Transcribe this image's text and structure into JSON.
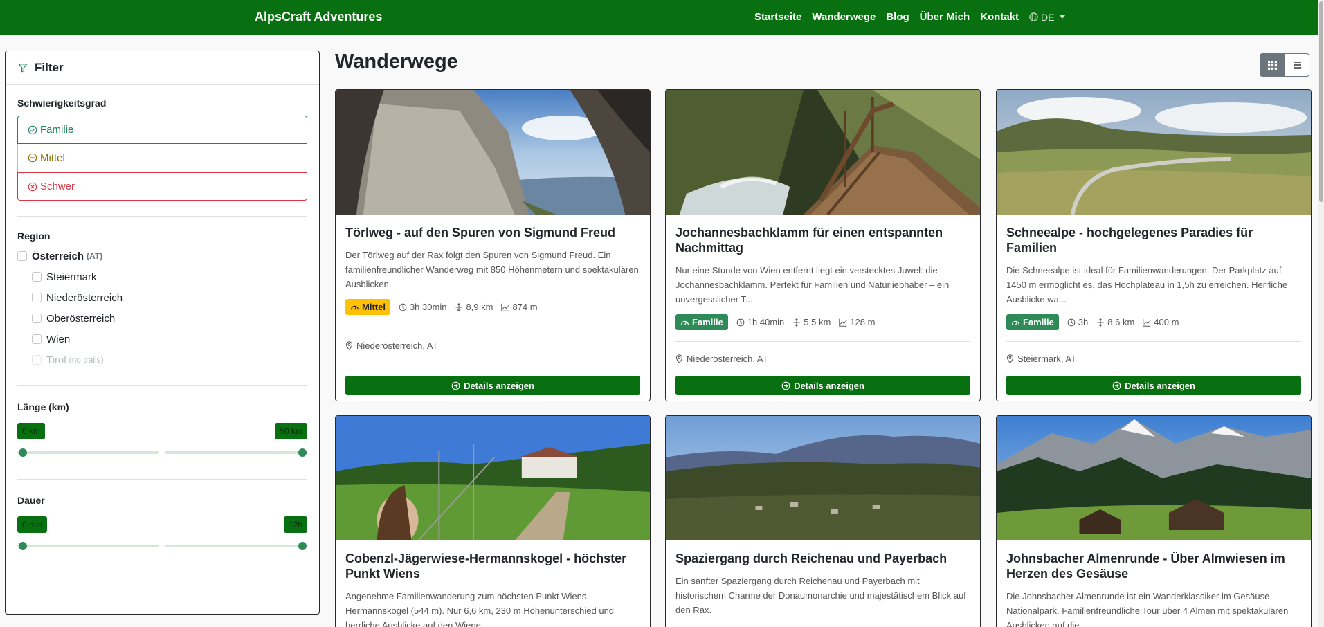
{
  "nav": {
    "brand": "AlpsCraft Adventures",
    "links": [
      "Startseite",
      "Wanderwege",
      "Blog",
      "Über Mich",
      "Kontakt"
    ],
    "lang": "DE"
  },
  "filter": {
    "title": "Filter",
    "difficulty": {
      "title": "Schwierigkeitsgrad",
      "options": [
        {
          "label": "Familie",
          "color": "#198754"
        },
        {
          "label": "Mittel",
          "color": "#b38600"
        },
        {
          "label": "Schwer",
          "color": "#dc3545"
        }
      ]
    },
    "region": {
      "title": "Region",
      "country": "Österreich",
      "country_code": "(AT)",
      "states": [
        "Steiermark",
        "Niederösterreich",
        "Oberösterreich",
        "Wien"
      ],
      "disabled_state": "Tirol",
      "disabled_note": "(no trails)"
    },
    "length": {
      "title": "Länge (km)",
      "min_label": "0 km",
      "max_label": "50 km"
    },
    "duration": {
      "title": "Dauer",
      "min_label": "0 min",
      "max_label": "12h"
    }
  },
  "main": {
    "title": "Wanderwege",
    "details_label": "Details anzeigen",
    "cards": [
      {
        "title": "Törlweg - auf den Spuren von Sigmund Freud",
        "desc": "Der Törlweg auf der Rax folgt den Spuren von Sigmund Freud. Ein familienfreundlicher Wanderweg mit 850 Höhenmetern und spektakulären Ausblicken.",
        "difficulty": "Mittel",
        "duration": "3h 30min",
        "distance": "8,9 km",
        "elevation": "874 m",
        "location": "Niederösterreich, AT"
      },
      {
        "title": "Jochannesbachklamm für einen entspannten Nachmittag",
        "desc": "Nur eine Stunde von Wien entfernt liegt ein verstecktes Juwel: die Jochannesbachklamm. Perfekt für Familien und Naturliebhaber – ein unvergesslicher T...",
        "difficulty": "Familie",
        "duration": "1h 40min",
        "distance": "5,5 km",
        "elevation": "128 m",
        "location": "Niederösterreich, AT"
      },
      {
        "title": "Schneealpe - hochgelegenes Paradies für Familien",
        "desc": "Die Schneealpe ist ideal für Familienwanderungen. Der Parkplatz auf 1450 m ermöglicht es, das Hochplateau in 1,5h zu erreichen. Herrliche Ausblicke wa...",
        "difficulty": "Familie",
        "duration": "3h",
        "distance": "8,6 km",
        "elevation": "400 m",
        "location": "Steiermark, AT"
      },
      {
        "title": "Cobenzl-Jägerwiese-Hermannskogel - höchster Punkt Wiens",
        "desc": "Angenehme Familienwanderung zum höchsten Punkt Wiens - Hermannskogel (544 m). Nur 6,6 km, 230 m Höhenunterschied und herrliche Ausblicke auf den Wiene..."
      },
      {
        "title": "Spaziergang durch Reichenau und Payerbach",
        "desc": "Ein sanfter Spaziergang durch Reichenau und Payerbach mit historischem Charme der Donaumonarchie und majestätischem Blick auf den Rax."
      },
      {
        "title": "Johnsbacher Almenrunde - Über Almwiesen im Herzen des Gesäuse",
        "desc": "Die Johnsbacher Almenrunde ist ein Wanderklassiker im Gesäuse Nationalpark. Familienfreundliche Tour über 4 Almen mit spektakulären Ausblicken auf die..."
      }
    ]
  }
}
